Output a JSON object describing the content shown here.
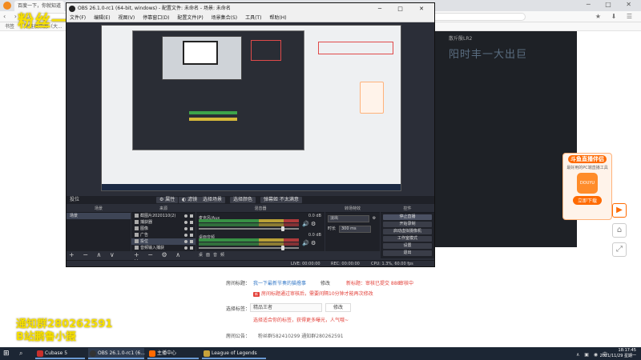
{
  "browser": {
    "tab_title": "百度一下，你就知道",
    "address": "",
    "bookmarks": [
      "书签",
      "除链接来源（大..."
    ]
  },
  "stream_page": {
    "watermark_top": "粉丝一份首",
    "watermark_bottom_line1": "通知群280262591",
    "watermark_bottom_line2": "B站鹏鲁小摄",
    "host_label": "散斤殷LR2",
    "big_text": "阳时丰一大出巨",
    "promo": {
      "title": "斗鱼直播伴侣",
      "desc": "最好用的PC端直播工具",
      "logo_text": "DOUYU",
      "button": "立即下载"
    },
    "settings": {
      "room_title_label": "房间标题：",
      "room_title_value": "我一下最新节奏的猫撸事",
      "edit_label": "修改",
      "status_label": "审核中",
      "status_prefix": "新标题：审核已提交 888",
      "review_notice": "房间标题通过审核后，需要间隔10分钟才能再次修改",
      "category_label": "选择标签：",
      "category_value": "精品王者",
      "category_edit": "修改",
      "category_notice": "选择适合你的标签，获得更多曝光，人气哦~",
      "announcement_label": "房间公告：",
      "announcement_value": "粉丝群582410299 通知群280262591"
    }
  },
  "obs": {
    "title": "OBS 26.1.0-rc1 (64-bit, windows) - 配置文件: 未命名 - 场景: 未命名",
    "menu": [
      "文件(F)",
      "编辑(E)",
      "视图(V)",
      "停靠窗口(D)",
      "配置文件(P)",
      "场景集合(S)",
      "工具(T)",
      "帮助(H)"
    ],
    "scene_bar": {
      "label": "投位",
      "properties": "属性",
      "filters": "滤镜",
      "select_scene": "选择场景",
      "select_color": "选择颜色",
      "stream_target": "弹幕姬 不太满意"
    },
    "docks": {
      "scenes": "场景",
      "sources": "来源",
      "mixer": "混音器",
      "transitions": "转场特效",
      "controls": "控件"
    },
    "scenes": [
      "场景"
    ],
    "sources": [
      "截图片2020110(2)",
      "捕获器",
      "图像",
      "广告",
      "投位",
      "音频输入捕获"
    ],
    "mixer": [
      {
        "name": "麦克风/Aux",
        "db": "0.0 dB",
        "level": 0.85
      },
      {
        "name": "桌面音频",
        "db": "0.0 dB",
        "level": 0.85
      }
    ],
    "mixer_footer": "桌面音频",
    "transition": {
      "type": "淡出",
      "duration_label": "时长",
      "duration": "300 ms"
    },
    "controls": [
      "停止直播",
      "开始录制",
      "启动虚拟摄像机",
      "工作室模式",
      "设置",
      "退出"
    ],
    "status": {
      "live": "LIVE: 00:00:00",
      "rec": "REC: 00:00:00",
      "cpu": "CPU: 1.3%, 60.00 fps"
    }
  },
  "taskbar": {
    "apps": [
      "Cubase 5",
      "OBS 26.1.0-rc1 (6...",
      "主播中心",
      "League of Legends"
    ],
    "time": "18:17:45",
    "date": "2021/11/29 星期一"
  },
  "colors": {
    "accent": "#ff6a00",
    "obs_bg": "#2b2e38",
    "link": "#3579c8",
    "warning": "#e3413a",
    "watermark": "#f6e000"
  }
}
